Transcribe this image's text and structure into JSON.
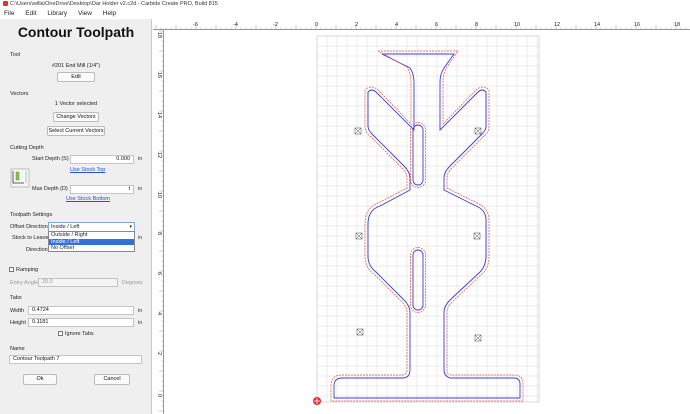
{
  "window": {
    "title": "C:\\Users\\willa\\OneDrive\\Desktop\\Oar Holder v2.c2d - Carbide Create PRO, Build 815"
  },
  "menu": [
    "File",
    "Edit",
    "Library",
    "View",
    "Help"
  ],
  "panel": {
    "title": "Contour Toolpath",
    "tool": {
      "heading": "Tool",
      "name": "#201 End Mill (1/4\")",
      "edit_label": "Edit"
    },
    "vectors": {
      "heading": "Vectors",
      "status": "1 Vector selected",
      "change_label": "Change Vectors",
      "select_current_label": "Select Current Vectors"
    },
    "cutting_depth": {
      "heading": "Cutting Depth",
      "start_label": "Start Depth (S)",
      "start_value": "0.000",
      "start_unit": "in",
      "use_stock_top": "Use Stock Top",
      "max_label": "Max Depth (D)",
      "max_value": "t",
      "max_unit": "in",
      "use_stock_bottom": "Use Stock Bottom"
    },
    "toolpath_settings": {
      "heading": "Toolpath Settings",
      "offset_label": "Offset Direction",
      "offset_value": "Inside / Left",
      "offset_options": [
        "Outside / Right",
        "Inside / Left",
        "No Offset"
      ],
      "stock_label": "Stock to Leave",
      "stock_unit": "in",
      "direction_label": "Direction"
    },
    "ramping": {
      "label": "Ramping",
      "entry_label": "Entry Angle",
      "entry_value": "20.0",
      "entry_unit": "Degrees"
    },
    "tabs": {
      "heading": "Tabs",
      "width_label": "Width",
      "width_value": "0.4724",
      "width_unit": "in",
      "height_label": "Height",
      "height_value": "0.1181",
      "height_unit": "in",
      "ignore_label": "Ignore Tabs"
    },
    "name": {
      "heading": "Name",
      "value": "Contour Toolpath 7"
    },
    "ok_label": "Ok",
    "cancel_label": "Cancel"
  },
  "ruler": {
    "top_labels": [
      "-6",
      "-4",
      "-2",
      "0",
      "2",
      "4",
      "6",
      "8",
      "10",
      "12",
      "14",
      "16",
      "18"
    ],
    "left_labels": [
      "18",
      "16",
      "14",
      "12",
      "10",
      "8",
      "6",
      "4",
      "2",
      "0"
    ]
  },
  "colors": {
    "contour_blue": "#3d3dd8",
    "offset_red": "#e0503a",
    "grid": "#d9d9d9",
    "accent_link": "#2a4fd8"
  }
}
